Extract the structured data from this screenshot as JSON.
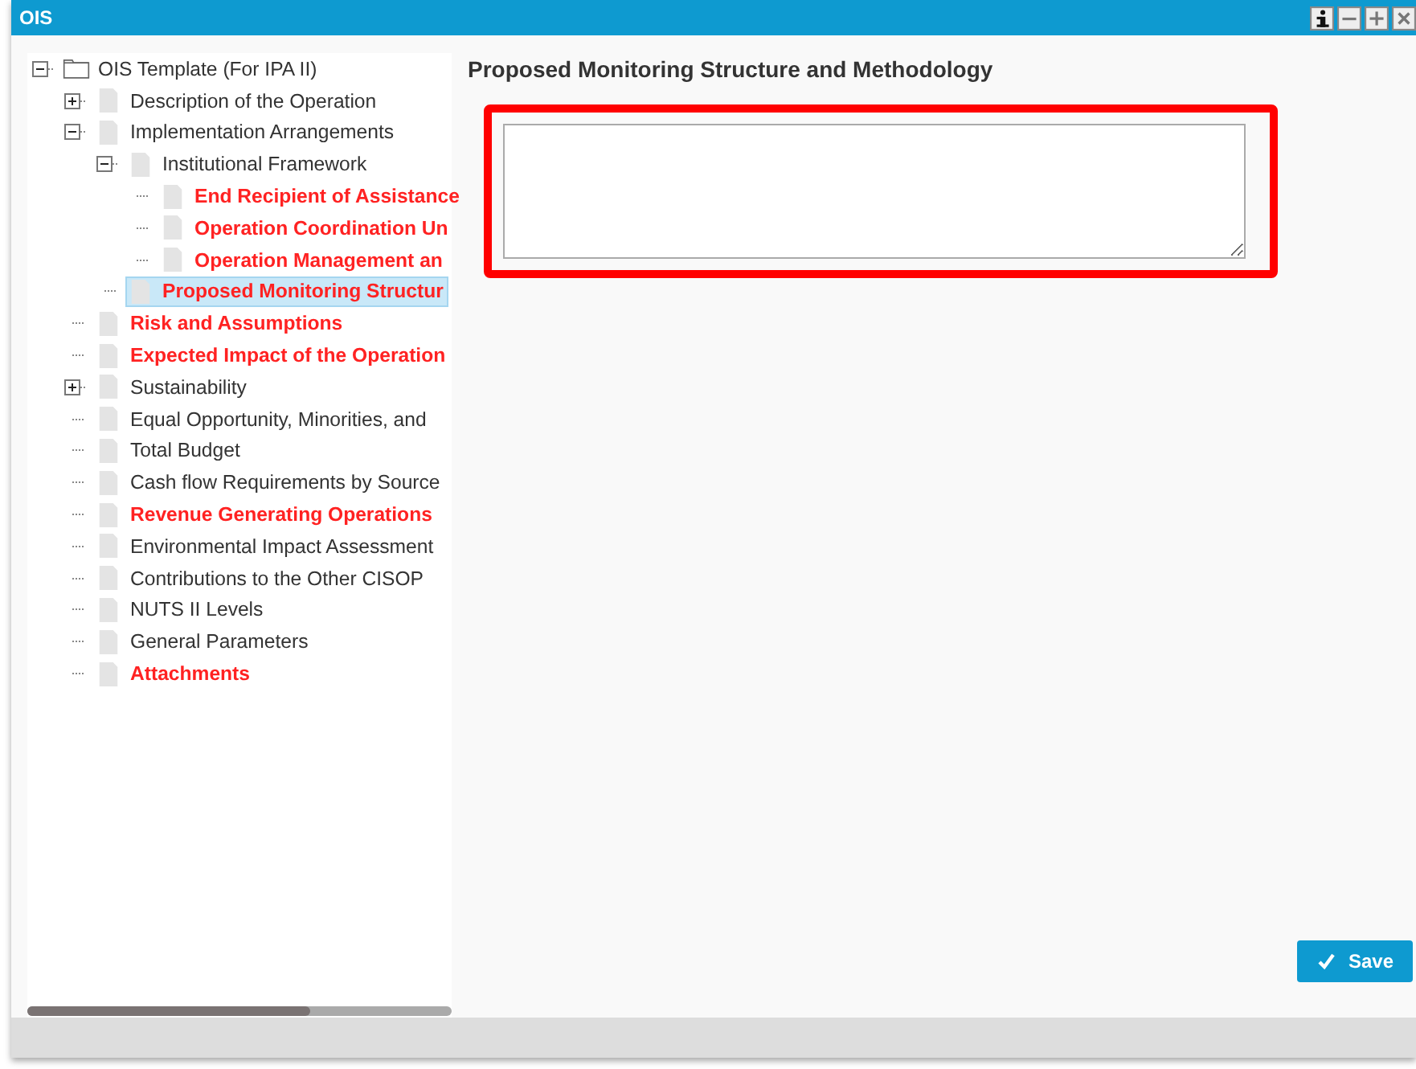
{
  "window": {
    "title": "OIS"
  },
  "tree": {
    "label": "OIS Template (For IPA II)",
    "expanded": true,
    "required": false,
    "selected": false,
    "kind": "folder",
    "children": [
      {
        "label": "Description of the Operation",
        "expanded": false,
        "has_children": true,
        "required": false,
        "selected": false
      },
      {
        "label": "Implementation Arrangements",
        "expanded": true,
        "required": false,
        "selected": false,
        "children": [
          {
            "label": "Institutional Framework",
            "expanded": true,
            "required": false,
            "selected": false,
            "children": [
              {
                "label": "End Recipient of Assistance",
                "required": true,
                "selected": false
              },
              {
                "label": "Operation Coordination Un",
                "required": true,
                "selected": false
              },
              {
                "label": "Operation Management an",
                "required": true,
                "selected": false
              }
            ]
          },
          {
            "label": "Proposed Monitoring Structur",
            "required": true,
            "selected": true
          }
        ]
      },
      {
        "label": "Risk and Assumptions",
        "required": true,
        "selected": false
      },
      {
        "label": "Expected Impact of the Operation",
        "required": true,
        "selected": false
      },
      {
        "label": "Sustainability",
        "expanded": false,
        "has_children": true,
        "required": false,
        "selected": false
      },
      {
        "label": "Equal Opportunity, Minorities, and",
        "required": false,
        "selected": false
      },
      {
        "label": "Total Budget",
        "required": false,
        "selected": false
      },
      {
        "label": "Cash flow Requirements by Source",
        "required": false,
        "selected": false
      },
      {
        "label": "Revenue Generating Operations",
        "required": true,
        "selected": false
      },
      {
        "label": "Environmental Impact Assessment",
        "required": false,
        "selected": false
      },
      {
        "label": "Contributions to the Other CISOP",
        "required": false,
        "selected": false
      },
      {
        "label": "NUTS II Levels",
        "required": false,
        "selected": false
      },
      {
        "label": "General Parameters",
        "required": false,
        "selected": false
      },
      {
        "label": "Attachments",
        "required": true,
        "selected": false
      }
    ]
  },
  "form": {
    "heading": "Proposed Monitoring Structure and Methodology",
    "highlighted": true
  },
  "save_button": {
    "label": "Save"
  }
}
